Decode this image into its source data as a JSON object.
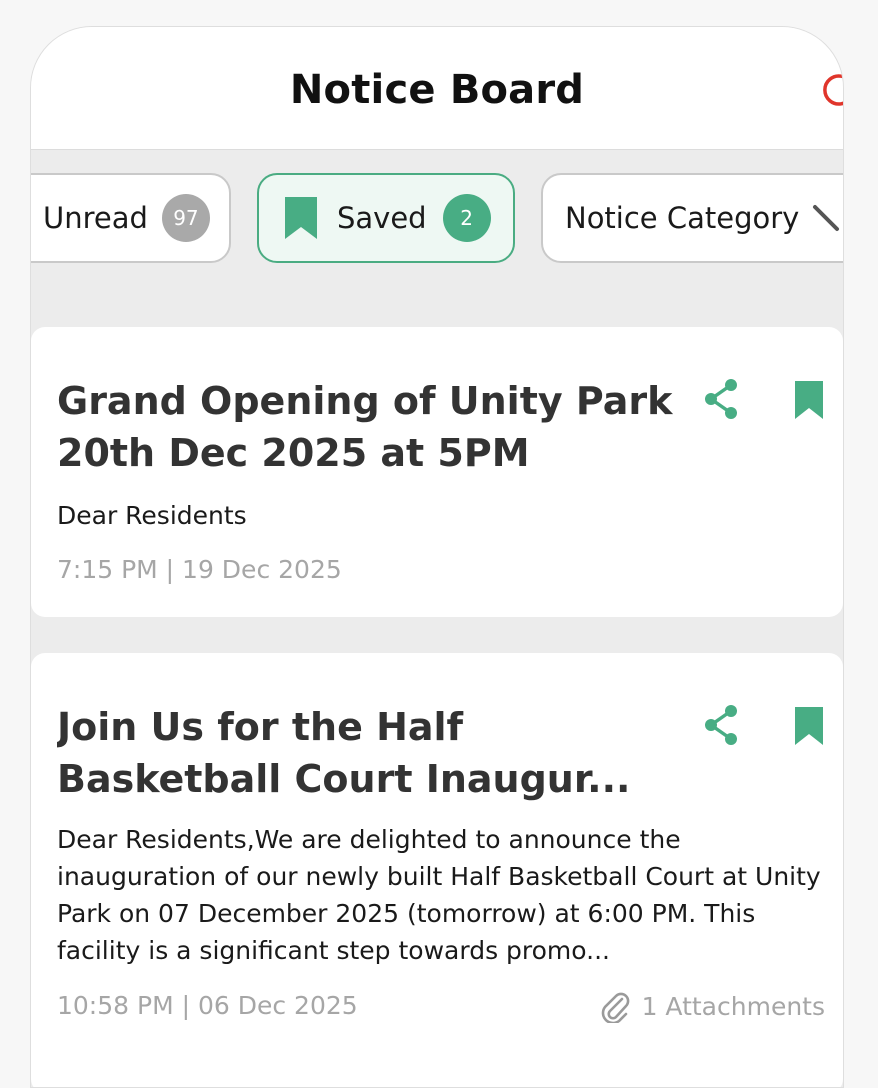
{
  "header": {
    "title": "Notice Board"
  },
  "filters": {
    "unread": {
      "label": "Unread",
      "count": "97"
    },
    "saved": {
      "label": "Saved",
      "count": "2"
    },
    "category": {
      "label": "Notice Category"
    }
  },
  "notices": [
    {
      "title": "Grand Opening of Unity Park  20th Dec 2025 at 5PM",
      "body": "Dear Residents",
      "meta": "7:15 PM | 19 Dec 2025"
    },
    {
      "title": "Join Us for the Half Basketball Court Inaugur...",
      "body": "Dear Residents,We are delighted to announce the inauguration of our newly built Half Basketball Court at Unity Park on 07 December 2025 (tomorrow) at 6:00 PM.   This facility is a significant step towards promo...",
      "meta": "10:58 PM | 06 Dec 2025",
      "attachments": "1 Attachments"
    }
  ],
  "icons": {
    "refresh": "refresh-icon",
    "bookmark": "bookmark-icon",
    "share": "share-icon",
    "pencil": "pencil-icon",
    "paperclip": "paperclip-icon"
  },
  "colors": {
    "accent": "#48ad84",
    "badge_grey": "#a9a9a9",
    "refresh_red": "#e0352b",
    "muted_text": "#a6a6a6",
    "title_text": "#333333"
  }
}
